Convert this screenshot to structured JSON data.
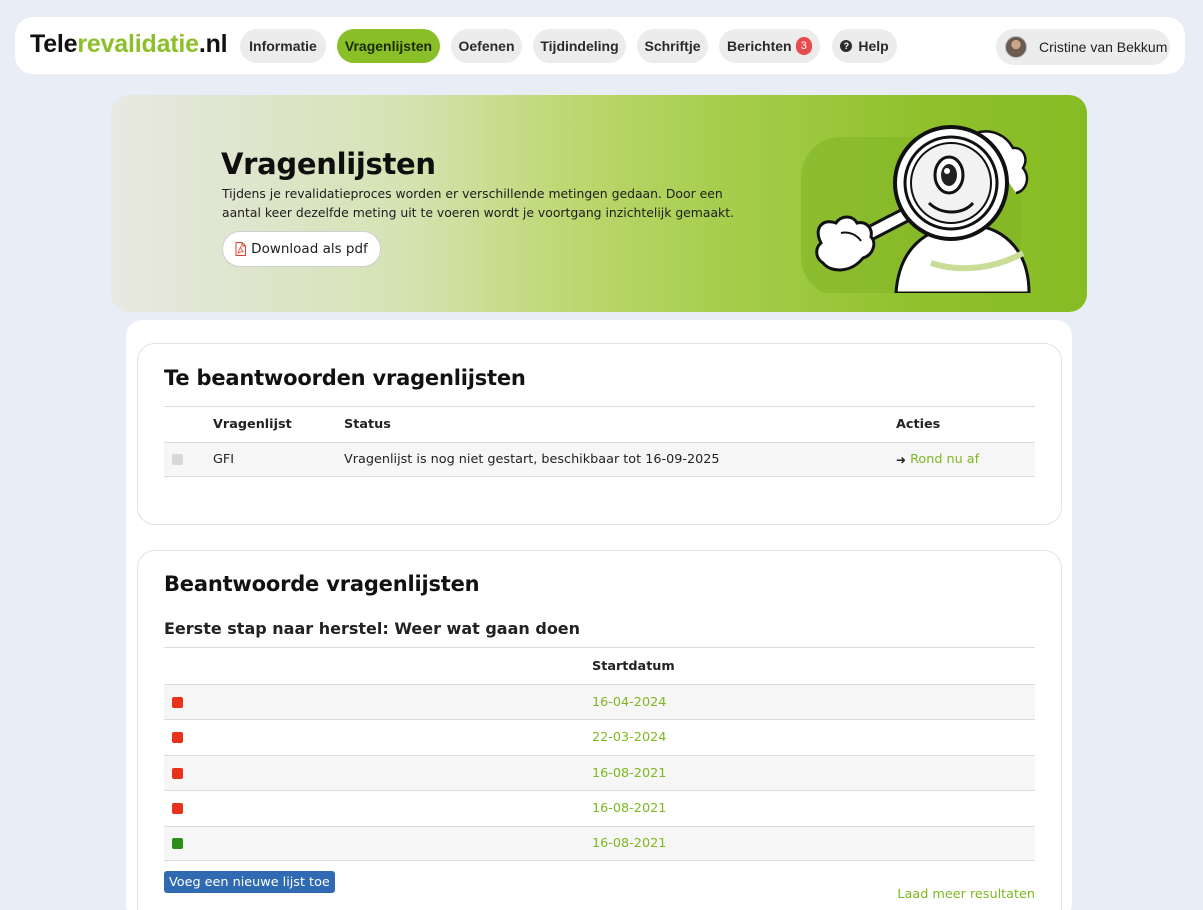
{
  "brand": {
    "part1": "Tele",
    "part2": "revalidatie",
    "part3": ".nl"
  },
  "nav": {
    "items": [
      {
        "label": "Informatie",
        "active": false
      },
      {
        "label": "Vragenlijsten",
        "active": true
      },
      {
        "label": "Oefenen",
        "active": false
      },
      {
        "label": "Tijdindeling",
        "active": false
      },
      {
        "label": "Schriftje",
        "active": false
      },
      {
        "label": "Berichten",
        "active": false,
        "badge": "3"
      },
      {
        "label": "Help",
        "active": false,
        "icon": "question-circle-icon"
      }
    ],
    "user_name": "Cristine van Bekkum"
  },
  "hero": {
    "title": "Vragenlijsten",
    "text": "Tijdens je revalidatieproces worden er verschillende metingen gedaan. Door een aantal keer dezelfde meting uit te voeren wordt je voortgang inzichtelijk gemaakt.",
    "pdf_button": "Download als pdf"
  },
  "pending": {
    "title": "Te beantwoorden vragenlijsten",
    "headers": {
      "questionnaire": "Vragenlijst",
      "status": "Status",
      "actions": "Acties"
    },
    "rows": [
      {
        "indicator": "grey",
        "questionnaire": "GFI",
        "status": "Vragenlijst is nog niet gestart, beschikbaar tot 16-09-2025",
        "action": "Rond nu af"
      }
    ]
  },
  "answered": {
    "title": "Beantwoorde vragenlijsten",
    "group_title": "Eerste stap naar herstel: Weer wat gaan doen",
    "headers": {
      "start_date": "Startdatum"
    },
    "rows": [
      {
        "indicator": "red",
        "start_date": "16-04-2024"
      },
      {
        "indicator": "red",
        "start_date": "22-03-2024"
      },
      {
        "indicator": "red",
        "start_date": "16-08-2021"
      },
      {
        "indicator": "red",
        "start_date": "16-08-2021"
      },
      {
        "indicator": "green",
        "start_date": "16-08-2021"
      }
    ],
    "add_button": "Voeg een nieuwe lijst toe",
    "load_more": "Laad meer resultaten"
  },
  "colors": {
    "accent": "#8abf28",
    "link": "#7db81f",
    "badge": "#e74c4c",
    "status_red": "#e8321c",
    "status_green": "#2b8e1a",
    "status_grey": "#d8d8d8",
    "button_blue": "#2f6ab3"
  }
}
